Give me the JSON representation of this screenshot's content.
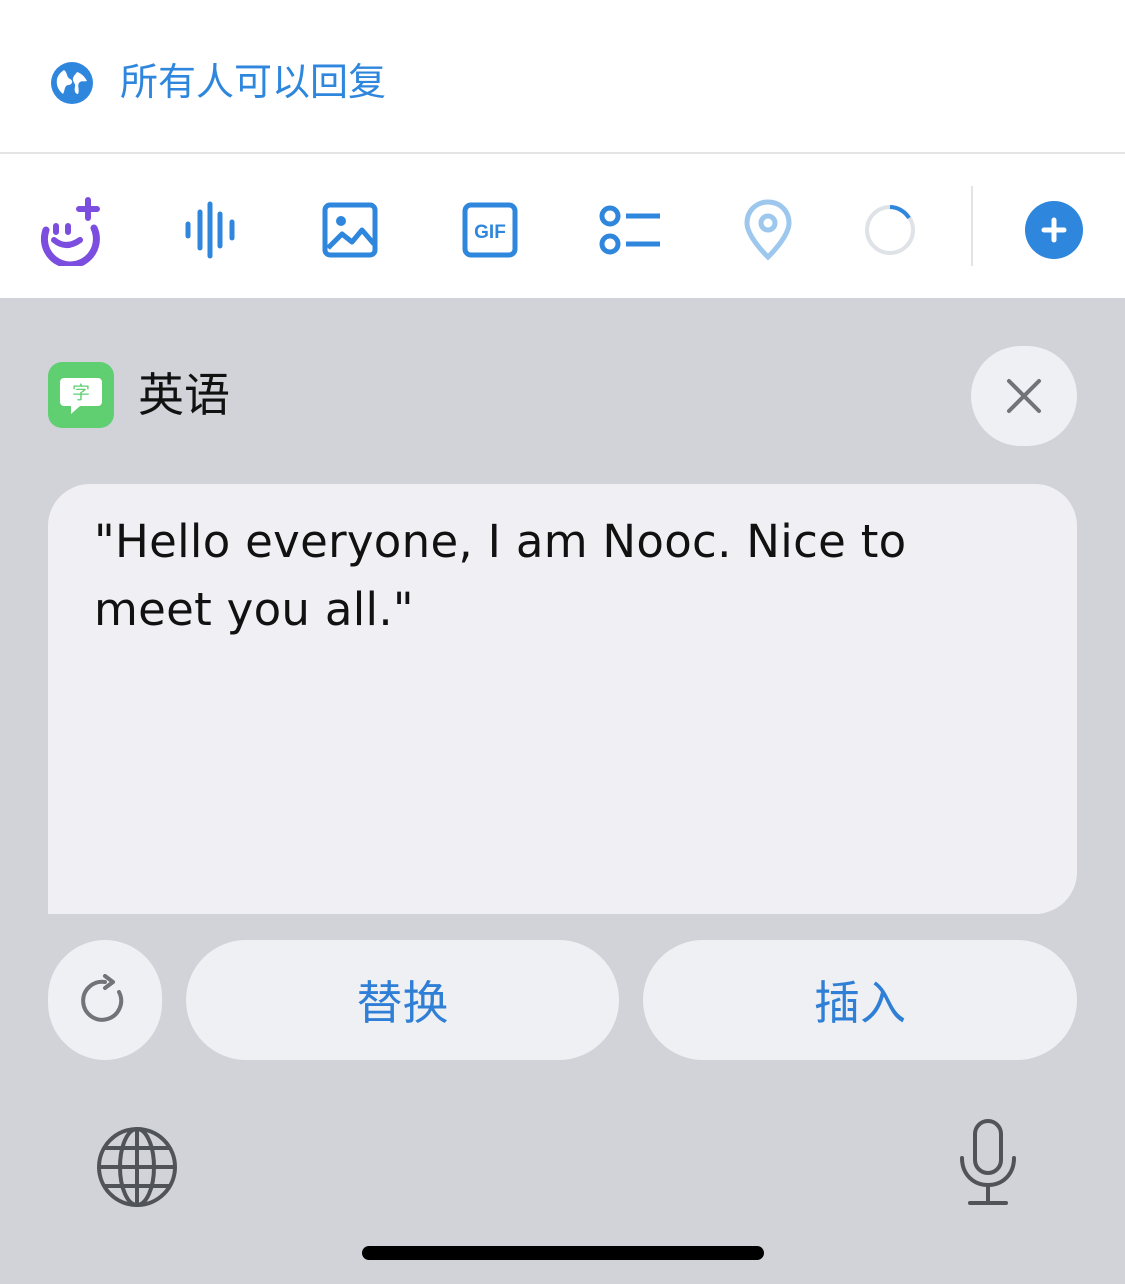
{
  "reply": {
    "label": "所有人可以回复",
    "icon": "globe-icon"
  },
  "toolbar": {
    "items": [
      {
        "name": "ai-persona-icon",
        "color": "#7b4ee0"
      },
      {
        "name": "voice-wave-icon",
        "color": "#2f86dd"
      },
      {
        "name": "image-icon",
        "color": "#2f86dd"
      },
      {
        "name": "gif-icon",
        "label": "GIF",
        "color": "#2f86dd"
      },
      {
        "name": "poll-list-icon",
        "color": "#2f86dd"
      },
      {
        "name": "location-pin-icon",
        "color": "#2f86dd"
      },
      {
        "name": "char-count-ring-icon",
        "color": "#c9cdd2"
      },
      {
        "name": "add-thread-icon",
        "color": "#2f86dd"
      }
    ]
  },
  "translation": {
    "badge_char": "字",
    "language": "英语",
    "text": "\"Hello everyone, I am Nooc. Nice to meet you all.\"",
    "replace_label": "替换",
    "insert_label": "插入"
  },
  "colors": {
    "accent": "#2f86dd",
    "panel_bg": "#d1d3d9",
    "badge_green": "#5fcf72"
  }
}
